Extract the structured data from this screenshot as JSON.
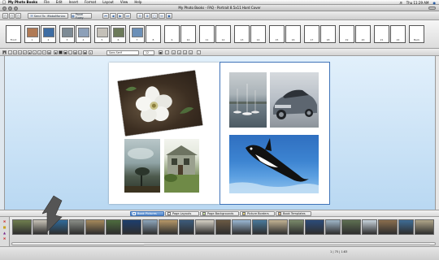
{
  "menubar": {
    "app_name": "My Photo Books",
    "items": [
      "File",
      "Edit",
      "Insert",
      "Format",
      "Layout",
      "View",
      "Help"
    ],
    "clock": "Thu 11:29 AM"
  },
  "window": {
    "title": "My Photo Books - FAQ - Portrait 8.5x11 Hard Cover"
  },
  "toolbar": {
    "send_label": "Send To: iMoboManiac",
    "panel_label": "Panel Fuzzy"
  },
  "page_strip": {
    "labels": [
      "Front",
      "1",
      "2",
      "3",
      "4",
      "5",
      "6",
      "7",
      "8",
      "9",
      "10",
      "11",
      "12",
      "13",
      "14",
      "15",
      "16",
      "17",
      "18",
      "19",
      "20",
      "21",
      "22",
      "Back"
    ]
  },
  "format_bar": {
    "font_value": "Sans Serif",
    "size_value": "12"
  },
  "tabs": [
    "Book Pictures",
    "Page Layouts",
    "Page Backgrounds",
    "Picture Borders",
    "Book Templates"
  ],
  "status": {
    "zoom_text": "1  | 75 | 1:83"
  },
  "colors": {
    "accent": "#3f73b8",
    "workspace_top": "#e2f0fb",
    "workspace_bottom": "#b9d8f2"
  }
}
